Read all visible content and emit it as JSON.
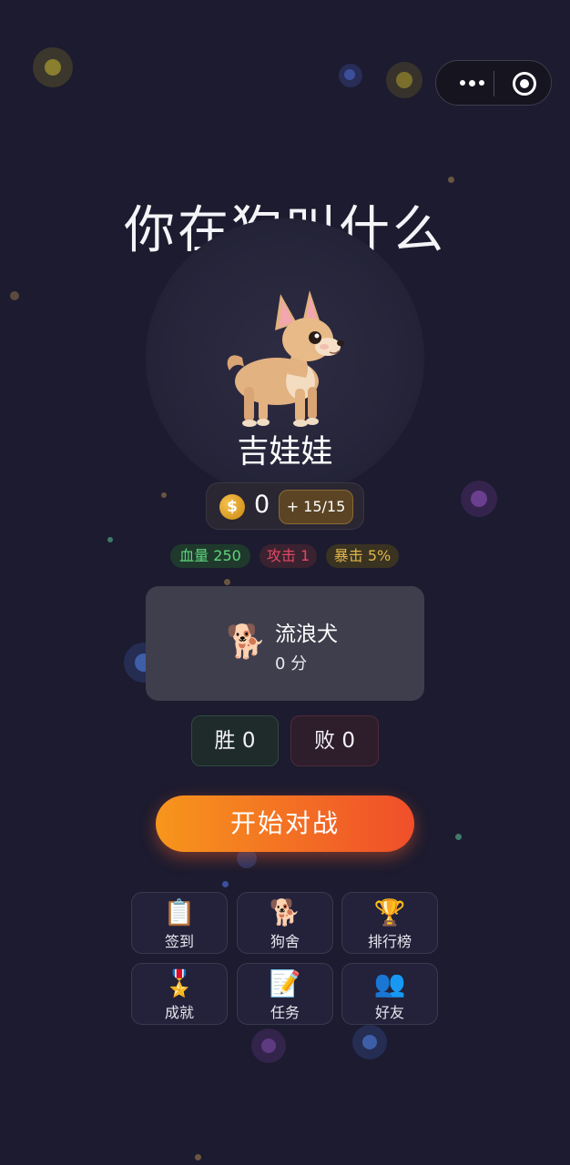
{
  "app": {
    "title": "你在狗叫什么"
  },
  "capsule": {
    "more_icon": "more-dots-icon",
    "close_icon": "target-close-icon"
  },
  "dog": {
    "name": "吉娃娃",
    "icon": "chihuahua-illustration"
  },
  "currency": {
    "icon_symbol": "$",
    "coins": "0",
    "energy_label": "+ 15/15"
  },
  "stats": {
    "hp": "血量 250",
    "attack": "攻击 1",
    "crit": "暴击 5%"
  },
  "opponent": {
    "icon": "🐕",
    "name": "流浪犬",
    "score": "0 分"
  },
  "record": {
    "win": "胜 0",
    "lose": "败 0"
  },
  "start_button": {
    "label": "开始对战"
  },
  "menu": [
    {
      "icon": "📋",
      "label": "签到"
    },
    {
      "icon": "🐕",
      "label": "狗舍"
    },
    {
      "icon": "🏆",
      "label": "排行榜"
    },
    {
      "icon": "🎖️",
      "label": "成就"
    },
    {
      "icon": "📝",
      "label": "任务"
    },
    {
      "icon": "👥",
      "label": "好友"
    }
  ],
  "colors": {
    "background": "#1c1b2f",
    "accent_start": "#f7961c",
    "accent_end": "#f04e2a",
    "hp": "#5ed47e",
    "attack": "#e04a62",
    "crit": "#e0b64a"
  }
}
